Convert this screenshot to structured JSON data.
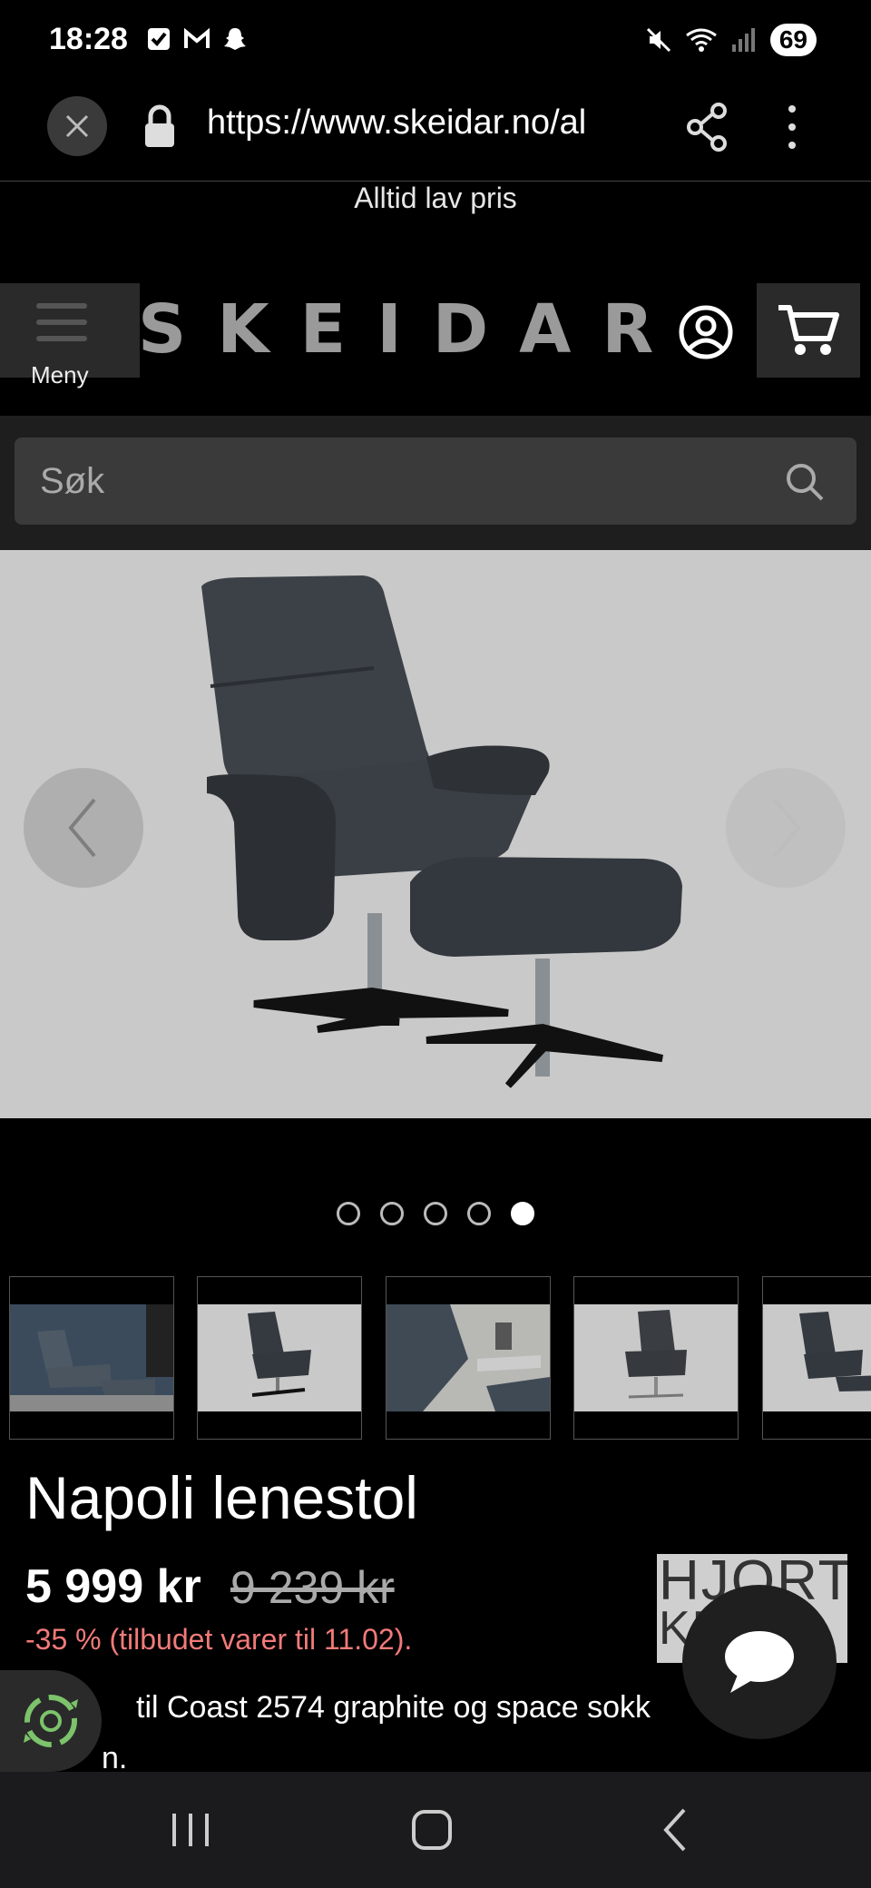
{
  "status_bar": {
    "time": "18:28",
    "battery": "69",
    "icons_left": [
      "checkbox-icon",
      "gmail-icon",
      "snapchat-icon"
    ],
    "icons_right": [
      "mute-icon",
      "wifi-icon",
      "signal-icon",
      "battery-icon"
    ]
  },
  "browser": {
    "url": "https://www.skeidar.no/al"
  },
  "promo": {
    "text": "Alltid lav pris"
  },
  "header": {
    "menu_label": "Meny",
    "logo": "SKEIDAR"
  },
  "search": {
    "placeholder": "Søk"
  },
  "gallery": {
    "dots_count": 5,
    "active_dot": 5,
    "thumbnail_count": 5
  },
  "product": {
    "title": "Napoli lenestol",
    "price": "5 999 kr",
    "old_price": "9 239 kr",
    "discount": "-35 % (tilbudet varer til 11.02).",
    "description_line1": "til Coast 2574 graphite og space sokk",
    "description_line2": "n.",
    "brand_top": "HJORT",
    "brand_bottom": "KN"
  },
  "colors": {
    "background": "#000000",
    "discount": "#f27a7a",
    "gallery_bg": "#c9c9c9",
    "eco_green": "#7cc36b"
  }
}
